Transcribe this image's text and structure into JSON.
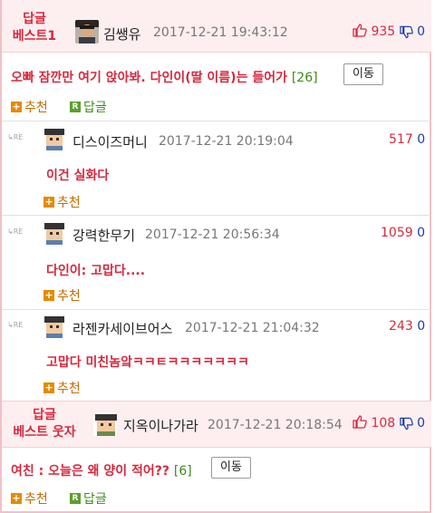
{
  "post1": {
    "badge_line1": "답글",
    "badge_line2": "베스트1",
    "author": "김쌩유",
    "date": "2017-12-21 19:43:12",
    "up": "935",
    "down": "0",
    "title": "오빠 잠깐만 여기 앉아봐. 다인이(딸 이름)는 들어가",
    "count": "[26]",
    "move": "이동",
    "recommend": "추천",
    "reply": "답글"
  },
  "replies": [
    {
      "re": "RE",
      "author": "디스이즈머니",
      "date": "2017-12-21 20:19:04",
      "up": "517",
      "down": "0",
      "text": "이건 실화다",
      "recommend": "추천"
    },
    {
      "re": "RE",
      "author": "강력한무기",
      "date": "2017-12-21 20:56:34",
      "up": "1059",
      "down": "0",
      "text": "다인이: 고맙다....",
      "recommend": "추천"
    },
    {
      "re": "RE",
      "author": "라젠카세이브어스",
      "date": "2017-12-21 21:04:32",
      "up": "243",
      "down": "0",
      "text": "고맙다 미친놈앜ㅋㅋㅌㅋㅋㅋㅋㅋㅋㅋ",
      "recommend": "추천"
    }
  ],
  "post2": {
    "badge_line1": "답글",
    "badge_line2": "베스트 웃자",
    "author": "지옥이나가라",
    "date": "2017-12-21 20:18:54",
    "up": "108",
    "down": "0",
    "title": "여친 : 오늘은 왜 양이 적어??",
    "count": "[6]",
    "move": "이동",
    "recommend": "추천",
    "reply": "답글"
  },
  "colors": {
    "accent": "#d6293e",
    "down": "#1a3da8",
    "green": "#3a8a1a",
    "orange": "#e58a00",
    "best_bg": "#fdeef0"
  },
  "icons": {
    "thumb_up": "thumb-up-icon",
    "thumb_down": "thumb-down-icon",
    "plus": "plus-icon",
    "reply": "reply-r-icon",
    "re": "re-arrow-icon"
  }
}
